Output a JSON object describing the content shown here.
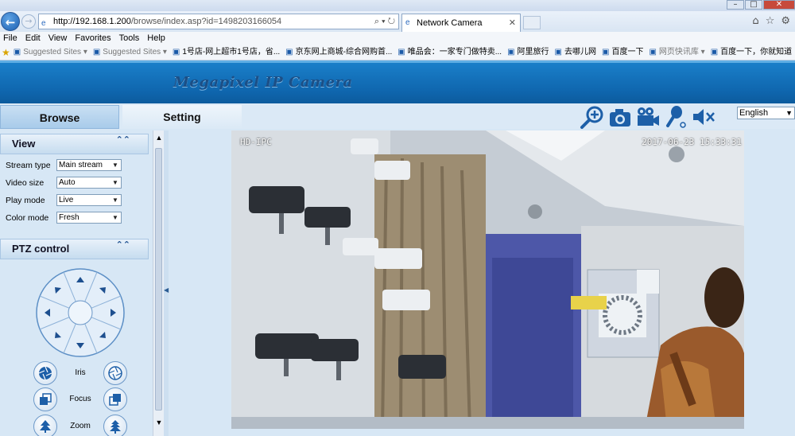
{
  "browser": {
    "address": {
      "host": "http://192.168.1.200",
      "path": "/browse/index.asp?id=1498203166054",
      "search_glyph": "⌕ ▾ ↻"
    },
    "tab": {
      "title": "Network Camera"
    },
    "menu": [
      "File",
      "Edit",
      "View",
      "Favorites",
      "Tools",
      "Help"
    ],
    "favorites": [
      {
        "label": "Suggested Sites ▾",
        "gray": true
      },
      {
        "label": "Suggested Sites ▾",
        "gray": true
      },
      {
        "label": "1号店-网上超市1号店，省...",
        "gray": false
      },
      {
        "label": "京东网上商城-综合网购首...",
        "gray": false
      },
      {
        "label": "唯品会：一家专门做特卖...",
        "gray": false
      },
      {
        "label": "阿里旅行",
        "gray": false
      },
      {
        "label": "去哪儿网",
        "gray": false
      },
      {
        "label": "百度一下",
        "gray": false
      },
      {
        "label": "网页快讯库 ▾",
        "gray": true
      },
      {
        "label": "百度一下，你就知道",
        "gray": false
      }
    ]
  },
  "app": {
    "brand": "Megapixel IP Camera",
    "tabs": {
      "browse": "Browse",
      "setting": "Setting"
    },
    "toolbar_icons": [
      "zoom-in-icon",
      "snapshot-camera-icon",
      "record-video-icon",
      "talk-microphone-icon",
      "mute-speaker-icon"
    ],
    "language": "English"
  },
  "view_panel": {
    "title": "View",
    "fields": [
      {
        "label": "Stream type",
        "value": "Main stream"
      },
      {
        "label": "Video size",
        "value": "Auto"
      },
      {
        "label": "Play mode",
        "value": "Live"
      },
      {
        "label": "Color mode",
        "value": "Fresh"
      }
    ]
  },
  "ptz_panel": {
    "title": "PTZ control",
    "rows": [
      {
        "label": "Iris"
      },
      {
        "label": "Focus"
      },
      {
        "label": "Zoom"
      }
    ]
  },
  "video": {
    "channel_name": "HD-IPC",
    "timestamp": "2017-06-23   15:33:31"
  },
  "colors": {
    "banner": "#0f66ae",
    "panel": "#d7e7f5",
    "icon_blue": "#1d5fa8"
  }
}
